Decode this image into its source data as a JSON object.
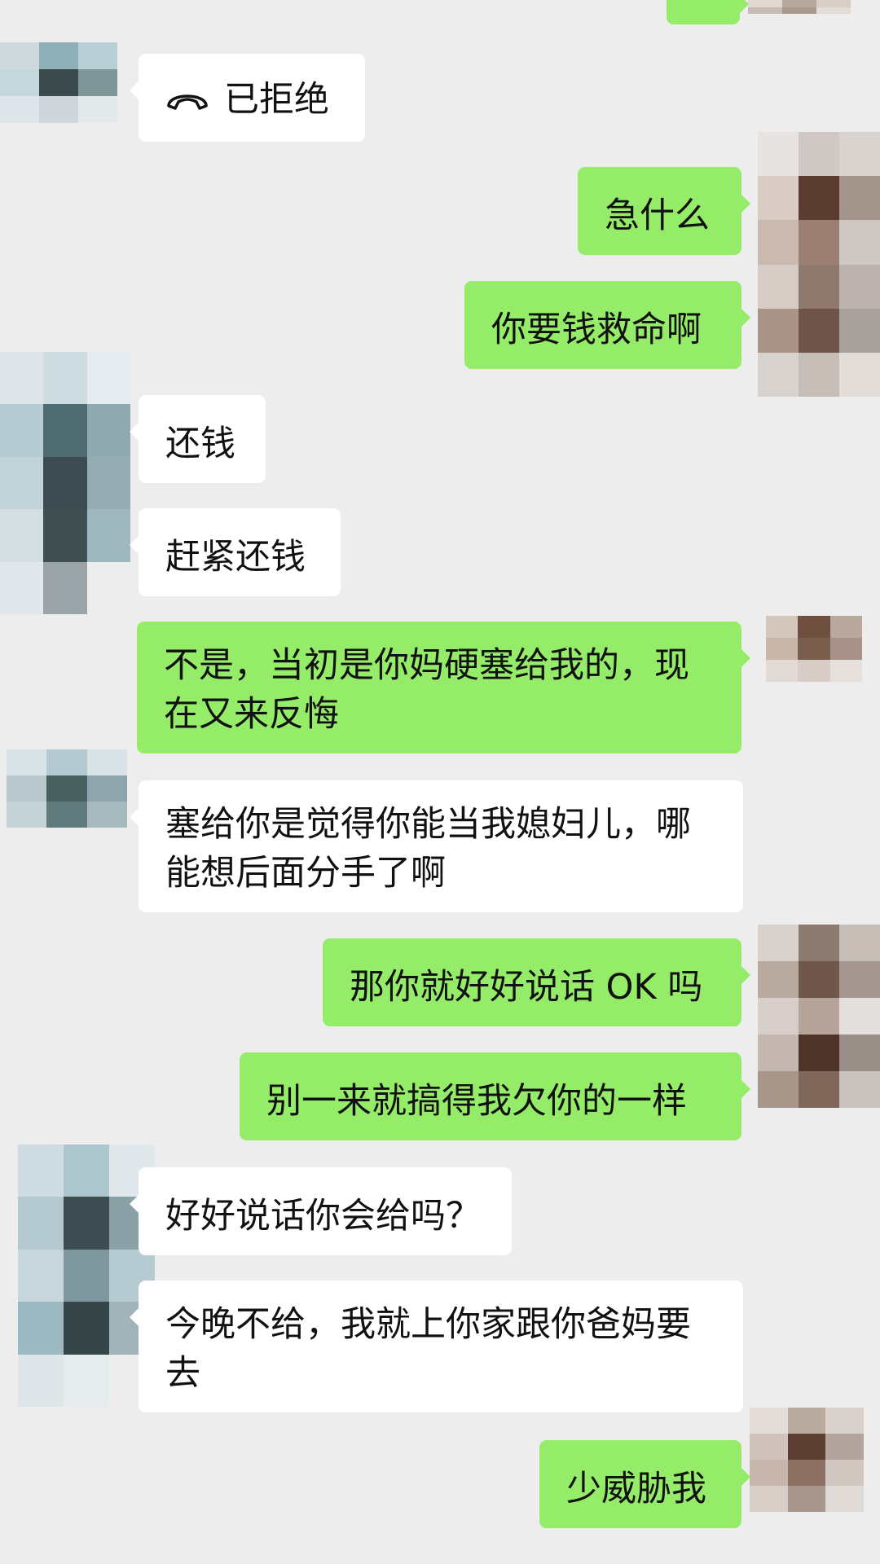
{
  "messages": [
    {
      "id": "m0",
      "side": "left",
      "type": "call",
      "icon": "phone-hangup-icon",
      "text": "已拒绝"
    },
    {
      "id": "m1",
      "side": "right",
      "text": "急什么"
    },
    {
      "id": "m2",
      "side": "right",
      "text": "你要钱救命啊"
    },
    {
      "id": "m3",
      "side": "left",
      "text": "还钱"
    },
    {
      "id": "m4",
      "side": "left",
      "text": "赶紧还钱"
    },
    {
      "id": "m5",
      "side": "right",
      "text": "不是，当初是你妈硬塞给我的，现在又来反悔"
    },
    {
      "id": "m6",
      "side": "left",
      "text": "塞给你是觉得你能当我媳妇儿，哪能想后面分手了啊"
    },
    {
      "id": "m7",
      "side": "right",
      "text": "那你就好好说话 OK 吗"
    },
    {
      "id": "m8",
      "side": "right",
      "text": "别一来就搞得我欠你的一样"
    },
    {
      "id": "m9",
      "side": "left",
      "text": "好好说话你会给吗？"
    },
    {
      "id": "m10",
      "side": "left",
      "text": "今晚不给，我就上你家跟你爸妈要去"
    },
    {
      "id": "m11",
      "side": "right",
      "text": "少威胁我"
    }
  ],
  "colors": {
    "background": "#ededed",
    "bubble_self": "#95ec69",
    "bubble_other": "#ffffff"
  }
}
